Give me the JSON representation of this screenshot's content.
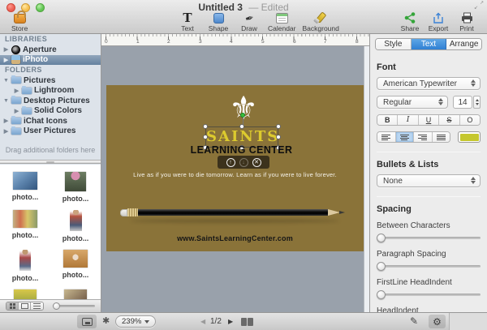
{
  "window": {
    "title": "Untitled 3",
    "edited_suffix": "— Edited"
  },
  "toolbar": {
    "store_label": "Store",
    "tools": [
      {
        "label": "Text"
      },
      {
        "label": "Shape"
      },
      {
        "label": "Draw"
      },
      {
        "label": "Calendar"
      },
      {
        "label": "Background"
      }
    ],
    "actions": [
      {
        "label": "Share"
      },
      {
        "label": "Export"
      },
      {
        "label": "Print"
      }
    ]
  },
  "sidebar": {
    "libraries_header": "LIBRARIES",
    "libraries": [
      {
        "label": "Aperture"
      },
      {
        "label": "iPhoto",
        "selected": true
      }
    ],
    "folders_header": "FOLDERS",
    "folders": [
      {
        "label": "Pictures"
      },
      {
        "label": "Lightroom"
      },
      {
        "label": "Desktop Pictures"
      },
      {
        "label": "Solid Colors"
      },
      {
        "label": "iChat Icons"
      },
      {
        "label": "User Pictures"
      }
    ],
    "drag_hint": "Drag additional folders here",
    "photos": [
      {
        "label": "photo..."
      },
      {
        "label": "photo..."
      },
      {
        "label": "photo..."
      },
      {
        "label": "photo..."
      },
      {
        "label": "photo..."
      },
      {
        "label": "photo..."
      },
      {
        "label": ""
      },
      {
        "label": ""
      }
    ]
  },
  "canvas": {
    "ruler": [
      "0",
      "1",
      "2",
      "3",
      "4",
      "5",
      "6",
      "7",
      "8"
    ],
    "design": {
      "logo_title": "SAINTS",
      "logo_subtitle": "LEARNING CENTER",
      "tagline": "Live as if you were to die tomorrow. Learn as if you were to live forever.",
      "website": "www.SaintsLearningCenter.com"
    }
  },
  "inspector": {
    "tabs": [
      {
        "label": "Style"
      },
      {
        "label": "Text",
        "active": true
      },
      {
        "label": "Arrange"
      }
    ],
    "font": {
      "header": "Font",
      "family": "American Typewriter",
      "style": "Regular",
      "size": "14",
      "style_buttons": [
        {
          "label": "B"
        },
        {
          "label": "I"
        },
        {
          "label": "U"
        },
        {
          "label": "S"
        },
        {
          "label": "O"
        }
      ]
    },
    "bullets": {
      "header": "Bullets & Lists",
      "value": "None"
    },
    "spacing": {
      "header": "Spacing",
      "sliders": [
        {
          "label": "Between Characters"
        },
        {
          "label": "Paragraph Spacing"
        },
        {
          "label": "FirstLine HeadIndent"
        },
        {
          "label": "HeadIndent"
        }
      ]
    }
  },
  "statusbar": {
    "zoom_level": "239%",
    "page_indicator": "1/2"
  },
  "colors": {
    "accent_blue": "#3f8fd9",
    "canvas_brown": "#8a7339",
    "saints_yellow": "#dcca2e",
    "text_color_well": "#c5c72e",
    "pasteboard_gray": "#99a1ab",
    "sidebar_selection": "#64819f"
  }
}
